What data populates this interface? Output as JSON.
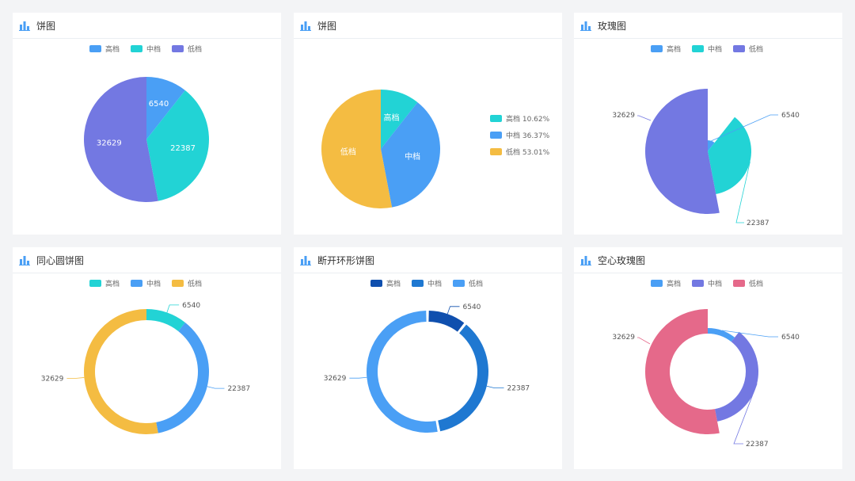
{
  "colors": {
    "blue": "#4a9ff5",
    "cyan": "#22d3d5",
    "purple": "#7378e2",
    "yellow": "#f4bc42",
    "navy": "#0f4fae",
    "mid_blue": "#1f78d1",
    "pink": "#e5698a"
  },
  "chart_data": [
    {
      "type": "pie",
      "title": "饼图",
      "legend": [
        "高档",
        "中档",
        "低档"
      ],
      "categories": [
        "高档",
        "中档",
        "低档"
      ],
      "values": [
        6540,
        22387,
        32629
      ],
      "labels": [
        "6540",
        "22387",
        "32629"
      ]
    },
    {
      "type": "pie",
      "title": "饼图",
      "categories": [
        "高档",
        "中档",
        "低档"
      ],
      "values": [
        6540,
        22387,
        32629
      ],
      "inner_labels": [
        "高档",
        "中档",
        "低档"
      ],
      "legend": [
        "高档 10.62%",
        "中档 36.37%",
        "低档 53.01%"
      ],
      "legend_position": "right"
    },
    {
      "type": "pie",
      "variant": "rose",
      "title": "玫瑰图",
      "legend": [
        "高档",
        "中档",
        "低档"
      ],
      "categories": [
        "高档",
        "中档",
        "低档"
      ],
      "values": [
        6540,
        22387,
        32629
      ],
      "labels": [
        "6540",
        "22387",
        "32629"
      ]
    },
    {
      "type": "pie",
      "variant": "donut",
      "title": "同心圆饼图",
      "legend": [
        "高档",
        "中档",
        "低档"
      ],
      "categories": [
        "高档",
        "中档",
        "低档"
      ],
      "values": [
        6540,
        22387,
        32629
      ],
      "labels": [
        "6540",
        "22387",
        "32629"
      ]
    },
    {
      "type": "pie",
      "variant": "split-donut",
      "title": "断开环形饼图",
      "legend": [
        "高档",
        "中档",
        "低档"
      ],
      "categories": [
        "高档",
        "中档",
        "低档"
      ],
      "values": [
        6540,
        22387,
        32629
      ],
      "labels": [
        "6540",
        "22387",
        "32629"
      ]
    },
    {
      "type": "pie",
      "variant": "hollow-rose",
      "title": "空心玫瑰图",
      "legend": [
        "高档",
        "中档",
        "低档"
      ],
      "categories": [
        "高档",
        "中档",
        "低档"
      ],
      "values": [
        6540,
        22387,
        32629
      ],
      "labels": [
        "6540",
        "22387",
        "32629"
      ]
    }
  ]
}
